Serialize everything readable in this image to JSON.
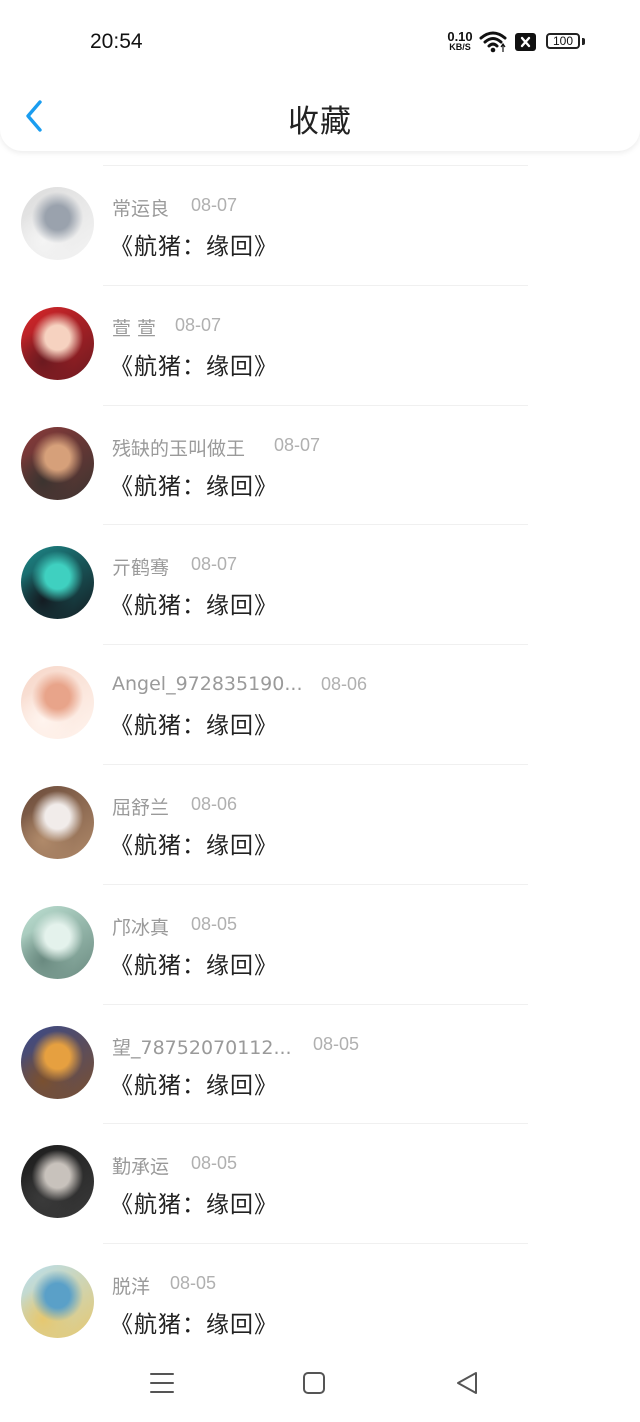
{
  "status_bar": {
    "time": "20:54",
    "net_speed_value": "0.10",
    "net_speed_unit": "KB/S",
    "battery": "100",
    "icons": [
      "wifi-icon",
      "close-box-icon",
      "battery-icon"
    ]
  },
  "header": {
    "title": "收藏",
    "back_icon": "chevron-left-icon"
  },
  "colors": {
    "accent": "#1a9df0",
    "name": "#9a9a9a",
    "date": "#b0b0b0",
    "title": "#222222"
  },
  "items": [
    {
      "name": "常运良",
      "date": "08-07",
      "title": "《航猪：缘回》",
      "avatar": [
        "#dcdcdc",
        "#9aa2ad",
        "#f4f4f4"
      ]
    },
    {
      "name": "萱 萱",
      "date": "08-07",
      "title": "《航猪：缘回》",
      "avatar": [
        "#d8262a",
        "#f6d2c0",
        "#6b1a20"
      ]
    },
    {
      "name": "残缺的玉叫做王",
      "date": "08-07",
      "title": "《航猪：缘回》",
      "avatar": [
        "#8a3a3a",
        "#d6a07a",
        "#3c3430"
      ]
    },
    {
      "name": "亓鹤骞",
      "date": "08-07",
      "title": "《航猪：缘回》",
      "avatar": [
        "#1d8a8a",
        "#3fd0c0",
        "#141c22"
      ]
    },
    {
      "name": "Angel_972835190...",
      "date": "08-06",
      "title": "《航猪：缘回》",
      "avatar": [
        "#f6d6c8",
        "#e8a48a",
        "#fff4ee"
      ]
    },
    {
      "name": "屈舒兰",
      "date": "08-06",
      "title": "《航猪：缘回》",
      "avatar": [
        "#6a4a3a",
        "#f1ecea",
        "#b08a6a"
      ]
    },
    {
      "name": "邝冰真",
      "date": "08-05",
      "title": "《航猪：缘回》",
      "avatar": [
        "#bfe2d4",
        "#e4f2ec",
        "#6a8a80"
      ]
    },
    {
      "name": "望_78752070112...",
      "date": "08-05",
      "title": "《航猪：缘回》",
      "avatar": [
        "#3a4a8a",
        "#e6a040",
        "#7a5030"
      ]
    },
    {
      "name": "勤承运",
      "date": "08-05",
      "title": "《航猪：缘回》",
      "avatar": [
        "#1c1c1c",
        "#c8c2bc",
        "#3a3a3a"
      ]
    },
    {
      "name": "脱洋",
      "date": "08-05",
      "title": "《航猪：缘回》",
      "avatar": [
        "#b8dff0",
        "#5aa0c8",
        "#e6c870"
      ]
    }
  ],
  "nav_bar": {
    "icons": [
      "menu-icon",
      "home-square-icon",
      "back-triangle-icon"
    ]
  }
}
